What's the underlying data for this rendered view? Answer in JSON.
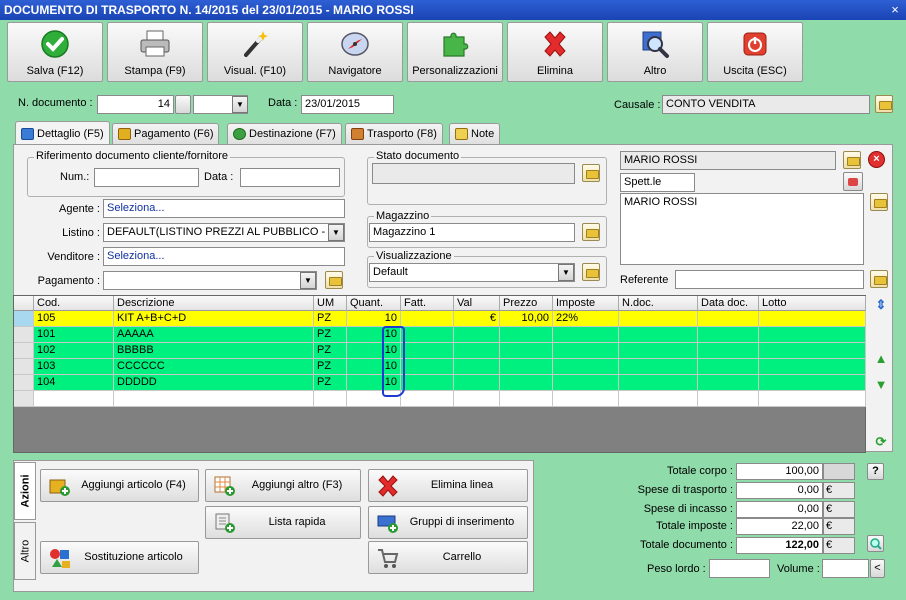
{
  "window": {
    "title": "DOCUMENTO DI TRASPORTO N. 14/2015 del 23/01/2015 - MARIO ROSSI",
    "close": "×"
  },
  "toolbar": [
    {
      "label": "Salva (F12)",
      "icon": "save-check-icon"
    },
    {
      "label": "Stampa (F9)",
      "icon": "printer-icon"
    },
    {
      "label": "Visual. (F10)",
      "icon": "magic-wand-icon"
    },
    {
      "label": "Navigatore",
      "icon": "compass-icon"
    },
    {
      "label": "Personalizzazioni",
      "icon": "puzzle-icon"
    },
    {
      "label": "Elimina",
      "icon": "delete-x-icon"
    },
    {
      "label": "Altro",
      "icon": "magnifier-icon"
    },
    {
      "label": "Uscita (ESC)",
      "icon": "power-icon"
    }
  ],
  "header": {
    "ndoc_label": "N. documento :",
    "ndoc_value": "14",
    "data_label": "Data :",
    "data_value": "23/01/2015",
    "causale_label": "Causale :",
    "causale_value": "CONTO VENDITA"
  },
  "tabs": [
    {
      "label": "Dettaglio (F5)",
      "active": true,
      "color": "#3a7bd5"
    },
    {
      "label": "Pagamento (F6)",
      "active": false,
      "color": "#e0b020"
    },
    {
      "label": "Destinazione (F7)",
      "active": false,
      "color": "#3aa040"
    },
    {
      "label": "Trasporto (F8)",
      "active": false,
      "color": "#d08030"
    },
    {
      "label": "Note",
      "active": false,
      "color": "#f0d050"
    }
  ],
  "detail": {
    "rif_title": "Riferimento documento cliente/fornitore",
    "num_label": "Num.:",
    "data_label": "Data :",
    "agente_label": "Agente :",
    "agente_value": "Seleziona...",
    "listino_label": "Listino :",
    "listino_value": "DEFAULT(LISTINO PREZZI AL PUBBLICO - E_C",
    "venditore_label": "Venditore :",
    "venditore_value": "Seleziona...",
    "pagamento_label": "Pagamento :",
    "stato_title": "Stato documento",
    "magazzino_title": "Magazzino",
    "magazzino_value": "Magazzino 1",
    "visual_title": "Visualizzazione",
    "visual_value": "Default",
    "cliente_name": "MARIO ROSSI",
    "cliente_title": "Spett.le",
    "cliente_address": "MARIO ROSSI",
    "referente_label": "Referente"
  },
  "grid": {
    "columns": [
      "Cod.",
      "Descrizione",
      "UM",
      "Quant.",
      "Fatt.",
      "Val",
      "Prezzo",
      "Imposte",
      "N.doc.",
      "Data doc.",
      "Lotto"
    ],
    "rows": [
      {
        "cod": "105",
        "descr": "KIT A+B+C+D",
        "um": "PZ",
        "quant": "10",
        "fatt": "",
        "val": "€",
        "prezzo": "10,00",
        "imposte": "22%",
        "color": "#ffff00"
      },
      {
        "cod": "101",
        "descr": "AAAAA",
        "um": "PZ",
        "quant": "10",
        "fatt": "",
        "val": "",
        "prezzo": "",
        "imposte": "",
        "color": "#00f080"
      },
      {
        "cod": "102",
        "descr": "BBBBB",
        "um": "PZ",
        "quant": "10",
        "fatt": "",
        "val": "",
        "prezzo": "",
        "imposte": "",
        "color": "#00f080"
      },
      {
        "cod": "103",
        "descr": "CCCCCC",
        "um": "PZ",
        "quant": "10",
        "fatt": "",
        "val": "",
        "prezzo": "",
        "imposte": "",
        "color": "#00f080"
      },
      {
        "cod": "104",
        "descr": "DDDDD",
        "um": "PZ",
        "quant": "10",
        "fatt": "",
        "val": "",
        "prezzo": "",
        "imposte": "",
        "color": "#00f080"
      },
      {
        "cod": "",
        "descr": "",
        "um": "",
        "quant": "",
        "fatt": "",
        "val": "",
        "prezzo": "",
        "imposte": "",
        "color": "#ffffff"
      }
    ]
  },
  "actions": {
    "tab_azioni": "Azioni",
    "tab_altro": "Altro",
    "buttons": [
      {
        "label": "Aggiungi articolo (F4)",
        "icon": "add-box-icon"
      },
      {
        "label": "Aggiungi altro (F3)",
        "icon": "add-grid-icon"
      },
      {
        "label": "Elimina linea",
        "icon": "delete-x-icon"
      },
      {
        "label": "Lista rapida",
        "icon": "quick-list-icon"
      },
      {
        "label": "Gruppi di inserimento",
        "icon": "group-insert-icon"
      },
      {
        "label": "Sostituzione articolo",
        "icon": "replace-shapes-icon"
      },
      {
        "label": "Carrello",
        "icon": "cart-icon"
      }
    ]
  },
  "totals": {
    "corpo_label": "Totale corpo :",
    "corpo_value": "100,00",
    "trasporto_label": "Spese di trasporto :",
    "trasporto_value": "0,00",
    "incasso_label": "Spese di incasso :",
    "incasso_value": "0,00",
    "imposte_label": "Totale imposte :",
    "imposte_value": "22,00",
    "documento_label": "Totale documento :",
    "documento_value": "122,00",
    "currency": "€",
    "help": "?",
    "peso_label": "Peso lordo :",
    "volume_label": "Volume :",
    "less": "<"
  }
}
